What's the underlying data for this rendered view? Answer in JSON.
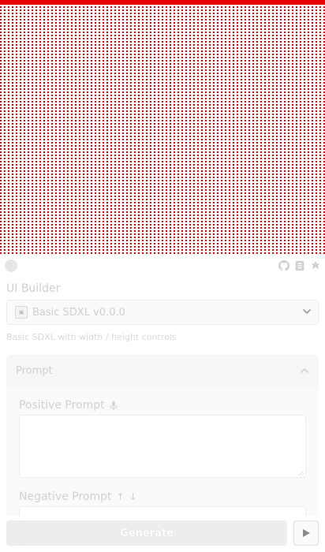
{
  "colors": {
    "canvas_pattern": "#e60000",
    "muted_text": "#cfcfcf",
    "panel_bg": "#fafafa"
  },
  "header": {
    "icons": [
      "logo-circle",
      "github-icon",
      "document-icon",
      "emblem-icon"
    ]
  },
  "ui_builder": {
    "label": "UI Builder",
    "selected_workflow": "Basic SDXL v0.0.0",
    "description": "Basic SDXL with width / height controls"
  },
  "prompt_panel": {
    "title": "Prompt",
    "positive_label": "Positive Prompt",
    "negative_label": "Negative Prompt",
    "positive_value": "",
    "negative_value": ""
  },
  "actions": {
    "generate_label": "Generate"
  }
}
